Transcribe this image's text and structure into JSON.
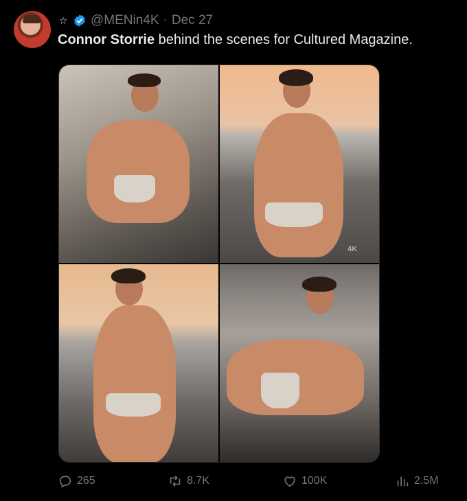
{
  "tweet": {
    "avatar_alt": "MENin4K avatar",
    "handle": "@MENin4K",
    "separator": "·",
    "date": "Dec 27",
    "text_bold": "Connor Storrie",
    "text_rest": " behind the scenes for Cultured Magazine.",
    "watermark": "4K",
    "stats": {
      "replies": "265",
      "retweets": "8.7K",
      "likes": "100K",
      "views": "2.5M"
    }
  },
  "colors": {
    "background": "#000000",
    "text": "#e7e9ea",
    "muted": "#71767b",
    "verified": "#1d9bf0"
  },
  "icons": [
    "star-icon",
    "verified-icon",
    "reply-icon",
    "retweet-icon",
    "like-icon",
    "views-icon"
  ]
}
